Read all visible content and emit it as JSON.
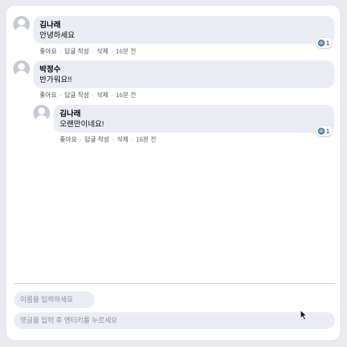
{
  "comments": [
    {
      "author": "김나래",
      "text": "안녕하세요",
      "actions": {
        "like": "좋아요",
        "reply": "답글 작성",
        "delete": "삭제",
        "time": "16분 전"
      },
      "likes": "1"
    },
    {
      "author": "박정수",
      "text": "반가워요!!",
      "actions": {
        "like": "좋아요",
        "reply": "답글 작성",
        "delete": "삭제",
        "time": "16분 전"
      }
    },
    {
      "author": "김나래",
      "text": "오랜만이네요!",
      "actions": {
        "like": "좋아요",
        "reply": "답글 작성",
        "delete": "삭제",
        "time": "16분 전"
      },
      "likes": "1"
    }
  ],
  "separator": "·",
  "form": {
    "name_placeholder": "이름을 입력하세요",
    "comment_placeholder": "댓글을 입력 후 엔터키를 누르세요"
  },
  "icons": {
    "avatar": "user-avatar-icon",
    "like": "thumbs-up-icon",
    "cursor": "mouse-pointer-icon"
  },
  "colors": {
    "like_badge": "#2f7ef5",
    "bubble": "#eaedf4",
    "background": "#e9ebf0"
  }
}
